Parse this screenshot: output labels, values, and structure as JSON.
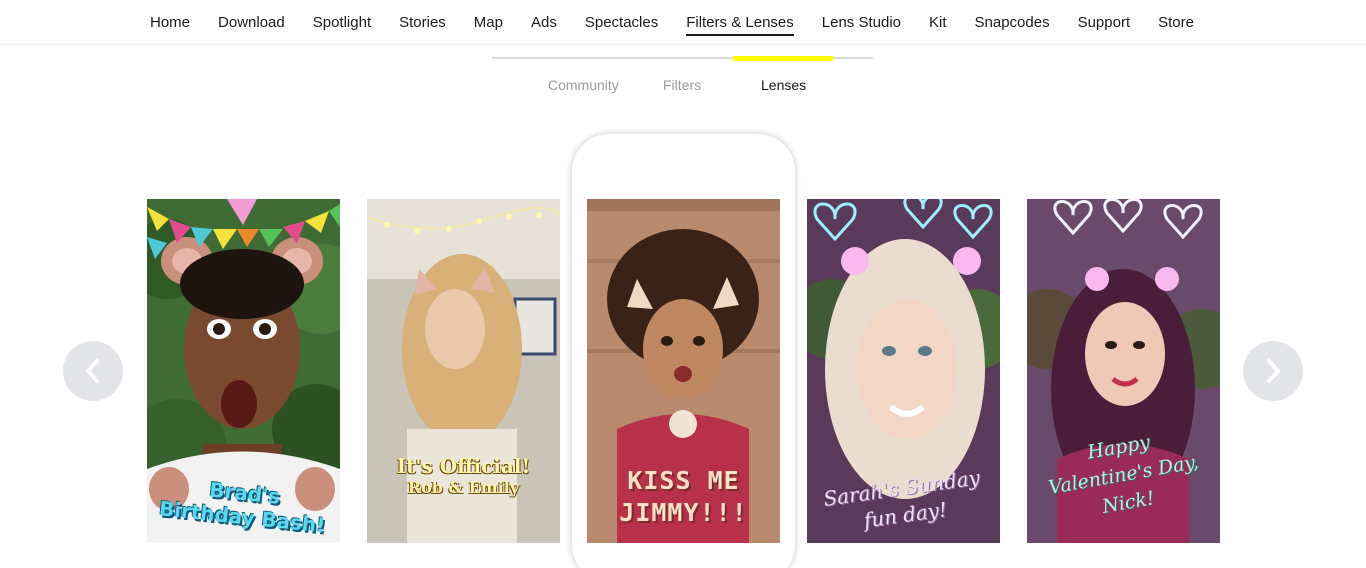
{
  "nav": {
    "items": [
      {
        "label": "Home"
      },
      {
        "label": "Download"
      },
      {
        "label": "Spotlight"
      },
      {
        "label": "Stories"
      },
      {
        "label": "Map"
      },
      {
        "label": "Ads"
      },
      {
        "label": "Spectacles"
      },
      {
        "label": "Filters & Lenses"
      },
      {
        "label": "Lens Studio"
      },
      {
        "label": "Kit"
      },
      {
        "label": "Snapcodes"
      },
      {
        "label": "Support"
      },
      {
        "label": "Store"
      }
    ],
    "active": "Filters & Lenses"
  },
  "subtabs": {
    "items": [
      {
        "label": "Community"
      },
      {
        "label": "Filters"
      },
      {
        "label": "Lenses"
      }
    ],
    "active": "Lenses",
    "indicator_color": "#fffc00"
  },
  "carousel": {
    "prev_icon": "chevron-left-icon",
    "next_icon": "chevron-right-icon",
    "cards": [
      {
        "caption_line1": "Brad's",
        "caption_line2": "Birthday Bash!"
      },
      {
        "caption_line1": "It's Official!",
        "caption_line2": "Rob & Emily"
      },
      {
        "caption_line1": "KISS ME",
        "caption_line2": "JIMMY!!!"
      },
      {
        "caption_line1": "Sarah's Sunday",
        "caption_line2": "fun day!"
      },
      {
        "caption_line1": "Happy",
        "caption_line2": "Valentine's Day,",
        "caption_line3": "Nick!"
      }
    ]
  },
  "colors": {
    "accent_yellow": "#fffc00",
    "arrow_bg": "#e2e4e8"
  }
}
